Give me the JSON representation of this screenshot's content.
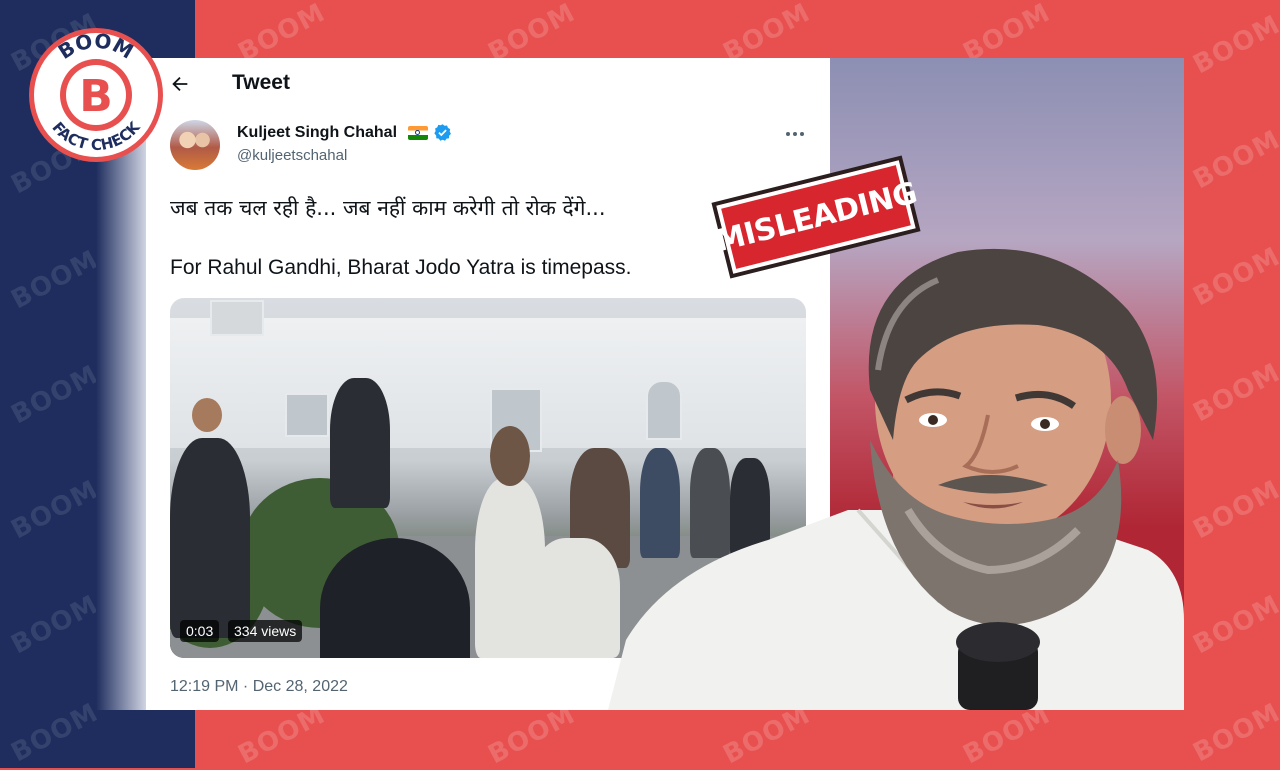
{
  "brand": {
    "watermark": "BOOM",
    "logo_top": "BOOM",
    "logo_bottom": "FACT CHECK",
    "logo_letter": "B",
    "colors": {
      "red": "#e8504f",
      "navy": "#1e2d5e",
      "stamp_red": "#d7262e"
    }
  },
  "tweet_page": {
    "back_icon": "arrow-left-icon",
    "title": "Tweet",
    "author": {
      "name": "Kuljeet Singh Chahal",
      "handle": "@kuljeetschahal",
      "flag_icon": "india-flag-icon",
      "verified_icon": "verified-badge-icon"
    },
    "more_icon": "more-horizontal-icon",
    "text_line_1": "जब तक चल रही है... जब नहीं काम करेगी तो रोक देंगे...",
    "text_line_2": "For Rahul Gandhi, Bharat Jodo Yatra is timepass.",
    "video": {
      "duration": "0:03",
      "views": "334 views"
    },
    "timestamp": "12:19 PM · Dec 28, 2022"
  },
  "stamp": {
    "text": "MISLEADING"
  }
}
